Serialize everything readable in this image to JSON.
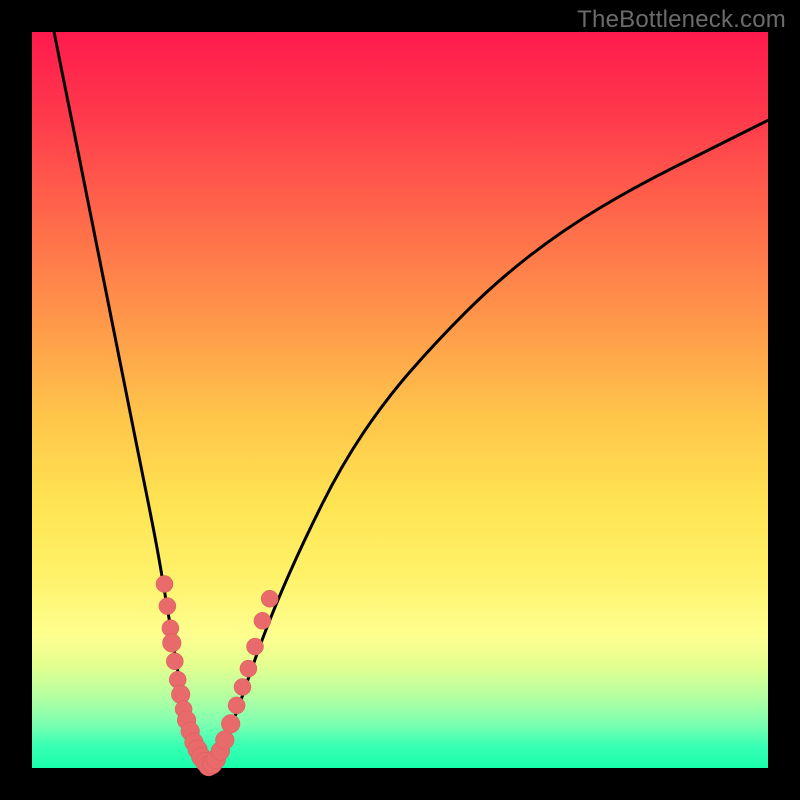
{
  "watermark": "TheBottleneck.com",
  "colors": {
    "frame": "#000000",
    "curve_stroke": "#000000",
    "marker_fill": "#e86a6a",
    "marker_stroke": "#d95b5b",
    "gradient_stops": [
      "#ff1a4d",
      "#ff3b4c",
      "#ff6b4a",
      "#ff934a",
      "#ffc44a",
      "#ffe452",
      "#fff26a",
      "#feff8f",
      "#e4ff8f",
      "#b8ffa0",
      "#7dffb0",
      "#38ffb3",
      "#19ffab"
    ]
  },
  "chart_data": {
    "type": "line",
    "title": "",
    "xlabel": "",
    "ylabel": "",
    "xlim": [
      0,
      100
    ],
    "ylim": [
      0,
      100
    ],
    "grid": false,
    "legend": false,
    "series": [
      {
        "name": "bottleneck-curve",
        "x": [
          3,
          5,
          7,
          9,
          11,
          13,
          15,
          17,
          18,
          19,
          20,
          21,
          22,
          23,
          24,
          25,
          26,
          28,
          30,
          33,
          37,
          42,
          48,
          55,
          63,
          72,
          82,
          92,
          100
        ],
        "y": [
          100,
          90,
          80,
          70,
          60,
          50,
          40,
          30,
          24,
          18,
          12,
          7,
          3,
          1,
          0,
          1,
          3,
          8,
          14,
          22,
          31,
          41,
          50,
          58,
          66,
          73,
          79,
          84,
          88
        ]
      }
    ],
    "markers": [
      {
        "x": 18.0,
        "y": 25.0,
        "r": 1.1
      },
      {
        "x": 18.4,
        "y": 22.0,
        "r": 1.1
      },
      {
        "x": 18.8,
        "y": 19.0,
        "r": 1.1
      },
      {
        "x": 19.0,
        "y": 17.0,
        "r": 1.3
      },
      {
        "x": 19.4,
        "y": 14.5,
        "r": 1.1
      },
      {
        "x": 19.8,
        "y": 12.0,
        "r": 1.1
      },
      {
        "x": 20.2,
        "y": 10.0,
        "r": 1.3
      },
      {
        "x": 20.6,
        "y": 8.0,
        "r": 1.1
      },
      {
        "x": 21.0,
        "y": 6.5,
        "r": 1.3
      },
      {
        "x": 21.5,
        "y": 5.0,
        "r": 1.3
      },
      {
        "x": 22.0,
        "y": 3.5,
        "r": 1.3
      },
      {
        "x": 22.5,
        "y": 2.5,
        "r": 1.4
      },
      {
        "x": 23.0,
        "y": 1.5,
        "r": 1.4
      },
      {
        "x": 23.5,
        "y": 0.8,
        "r": 1.4
      },
      {
        "x": 24.0,
        "y": 0.3,
        "r": 1.5
      },
      {
        "x": 24.5,
        "y": 0.5,
        "r": 1.4
      },
      {
        "x": 25.0,
        "y": 1.2,
        "r": 1.4
      },
      {
        "x": 25.6,
        "y": 2.3,
        "r": 1.3
      },
      {
        "x": 26.2,
        "y": 3.8,
        "r": 1.3
      },
      {
        "x": 27.0,
        "y": 6.0,
        "r": 1.3
      },
      {
        "x": 27.8,
        "y": 8.5,
        "r": 1.1
      },
      {
        "x": 28.6,
        "y": 11.0,
        "r": 1.1
      },
      {
        "x": 29.4,
        "y": 13.5,
        "r": 1.1
      },
      {
        "x": 30.3,
        "y": 16.5,
        "r": 1.1
      },
      {
        "x": 31.3,
        "y": 20.0,
        "r": 1.1
      },
      {
        "x": 32.3,
        "y": 23.0,
        "r": 1.1
      }
    ]
  }
}
